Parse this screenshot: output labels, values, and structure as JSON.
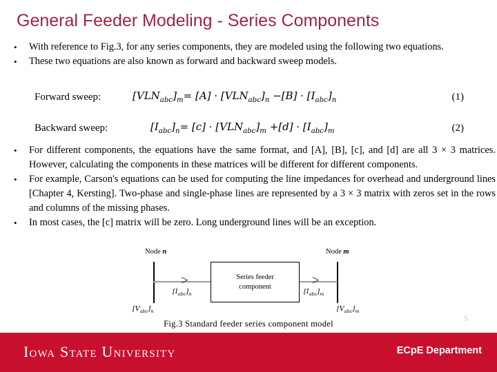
{
  "slide": {
    "title": "General Feeder Modeling - Series Components",
    "title_color": "#9e2542",
    "page_number": "5"
  },
  "bullets_top": [
    "With reference to Fig.3, for any series components, they are modeled using the following two equations.",
    "These two equations are also known as forward and backward sweep models."
  ],
  "equations": [
    {
      "label": "Forward sweep:",
      "lhs": "[VLN",
      "lhs_sub": "abc",
      "text": "[VLNabc]m = [A] · [VLNabc]n − [B] · [Iabc]n",
      "number": "(1)"
    },
    {
      "label": "Backward sweep:",
      "text": "[Iabc]n = [c] · [VLNabc]m + [d] · [Iabc]m",
      "number": "(2)"
    }
  ],
  "bullets_mid": [
    "For different components, the equations have the same format, and [A], [B], [c], and [d] are all 3 × 3 matrices. However, calculating the components in these matrices will be different for different components.",
    "For example, Carson's equations can be used for computing the line impedances for overhead and underground lines [Chapter 4, Kersting]. Two-phase and single-phase lines are represented by a 3 × 3 matrix with zeros set in the rows and columns of the missing phases.",
    "In most cases, the [c] matrix will be zero. Long underground lines will be an exception."
  ],
  "figure": {
    "node_left": "Node n",
    "node_right": "Node m",
    "box_line1": "Series feeder",
    "box_line2": "component",
    "current_left": "[Iabc]n",
    "current_right": "[Iabc]m",
    "voltage_left": "[Vabc]n",
    "voltage_right": "[Vabc]m",
    "caption": "Fig.3 Standard feeder series component model"
  },
  "footer": {
    "university": "Iowa State University",
    "department": "ECpE Department",
    "background": "#c8102e"
  }
}
